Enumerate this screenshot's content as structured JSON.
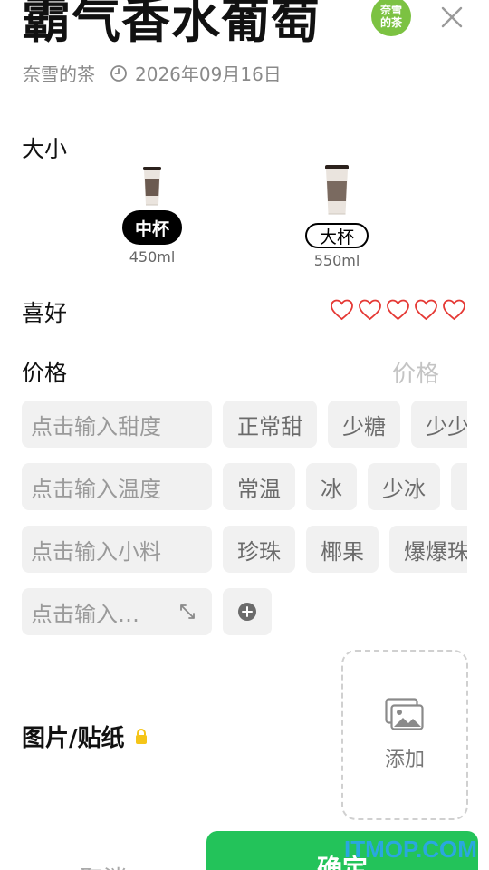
{
  "header": {
    "title": "霸气香水葡萄",
    "brand_badge": "奈雪\n的茶",
    "shop": "奈雪的茶",
    "date": "2026年09月16日"
  },
  "size": {
    "label": "大小",
    "options": [
      {
        "label": "中杯",
        "volume": "450ml",
        "selected": true
      },
      {
        "label": "大杯",
        "volume": "550ml",
        "selected": false
      }
    ]
  },
  "preference": {
    "label": "喜好",
    "rating": 0,
    "max": 5
  },
  "price": {
    "label": "价格",
    "placeholder": "价格"
  },
  "sweetness": {
    "placeholder": "点击输入甜度",
    "options": [
      "正常甜",
      "少糖",
      "少少"
    ]
  },
  "temperature": {
    "placeholder": "点击输入温度",
    "options": [
      "常温",
      "冰",
      "少冰",
      ""
    ]
  },
  "toppings": {
    "placeholder": "点击输入小料",
    "options": [
      "珍珠",
      "椰果",
      "爆爆珠"
    ]
  },
  "custom": {
    "placeholder": "点击输入…"
  },
  "photo": {
    "label": "图片/贴纸",
    "add_label": "添加"
  },
  "footer": {
    "cancel": "取消",
    "confirm": "确定"
  },
  "watermark": "ITMOP.COM",
  "colors": {
    "accent_green": "#23c35a",
    "heart_red": "#e53935",
    "lock_yellow": "#f5c518",
    "brand_green": "#7cc242"
  }
}
